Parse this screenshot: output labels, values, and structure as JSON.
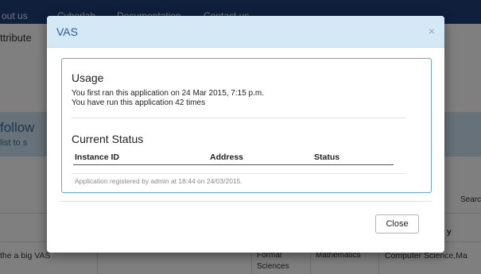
{
  "nav": {
    "items": [
      "out us",
      "Cyberlab",
      "Documentation",
      "Contact us"
    ]
  },
  "background": {
    "attribute_heading": "ttribute",
    "band_title": "follow",
    "band_subtitle": "list to s",
    "search_label": "Searc",
    "column_fragment": "y",
    "row_text_left": "the a big VAS",
    "row_cell_sciences_1": "Formal",
    "row_cell_sciences_2": "Sciences",
    "row_cell_math": "Mathematics",
    "row_cell_cs": "Computer Science,Ma"
  },
  "modal": {
    "title": "VAS",
    "close_symbol": "×",
    "usage": {
      "heading": "Usage",
      "first_ran": "You first ran this application on 24 Mar 2015, 7:15 p.m.",
      "run_count": "You have run this application 42 times"
    },
    "status": {
      "heading": "Current Status",
      "columns": [
        "Instance ID",
        "Address",
        "Status"
      ]
    },
    "registered_note": "Application registered by admin at 18:44 on 24/03/2015.",
    "close_button": "Close"
  },
  "colors": {
    "navbar": "#1f3e78",
    "modal_header": "#d5e8f6",
    "panel_border": "#6aa6d6",
    "title_text": "#2b5f8e"
  }
}
